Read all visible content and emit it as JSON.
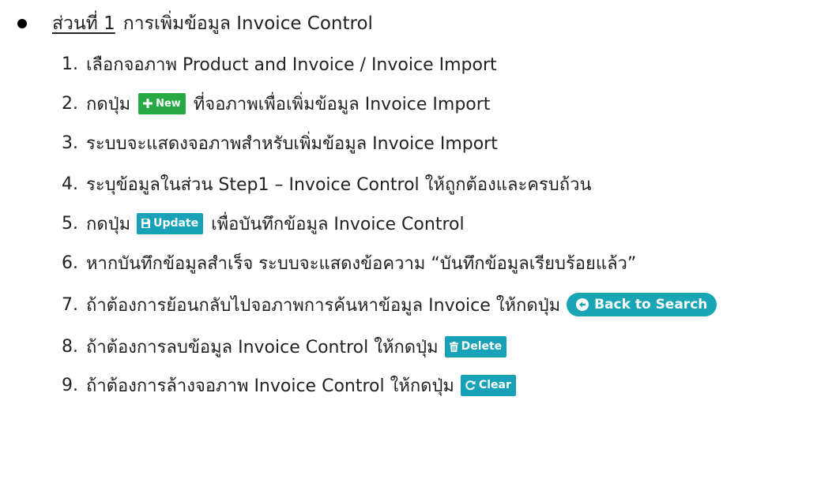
{
  "section": {
    "label": "ส่วนที่ 1",
    "title": "การเพิ่มข้อมูล Invoice Control"
  },
  "steps": [
    {
      "num": "1.",
      "text": "เลือกจอภาพ Product and Invoice / Invoice Import"
    },
    {
      "num": "2.",
      "before": "กดปุ่ม",
      "after": "ที่จอภาพเพื่อเพิ่มข้อมูล Invoice Import"
    },
    {
      "num": "3.",
      "text": "ระบบจะแสดงจอภาพสำหรับเพิ่มข้อมูล Invoice Import"
    },
    {
      "num": "4.",
      "text": "ระบุข้อมูลในส่วน Step1 – Invoice Control ให้ถูกต้องและครบถ้วน"
    },
    {
      "num": "5.",
      "before": "กดปุ่ม",
      "after": "เพื่อบันทึกข้อมูล Invoice Control"
    },
    {
      "num": "6.",
      "text": "หากบันทึกข้อมูลสำเร็จ ระบบจะแสดงข้อความ “บันทึกข้อมูลเรียบร้อยแล้ว”"
    },
    {
      "num": "7.",
      "before": "ถ้าต้องการย้อนกลับไปจอภาพการค้นหาข้อมูล Invoice ให้กดปุ่ม"
    },
    {
      "num": "8.",
      "before": "ถ้าต้องการลบข้อมูล Invoice Control ให้กดปุ่ม"
    },
    {
      "num": "9.",
      "before": "ถ้าต้องการล้างจอภาพ Invoice Control ให้กดปุ่ม"
    }
  ],
  "buttons": {
    "new": {
      "label": "New",
      "icon": "plus-icon",
      "color": "#28a745"
    },
    "update": {
      "label": "Update",
      "icon": "save-icon",
      "color": "#17a2b8"
    },
    "back": {
      "label": "Back to Search",
      "icon": "arrow-left-circle-icon",
      "color": "#1aa5b5"
    },
    "delete": {
      "label": "Delete",
      "icon": "trash-icon",
      "color": "#17a2b8"
    },
    "clear": {
      "label": "Clear",
      "icon": "refresh-icon",
      "color": "#17a2b8"
    }
  }
}
